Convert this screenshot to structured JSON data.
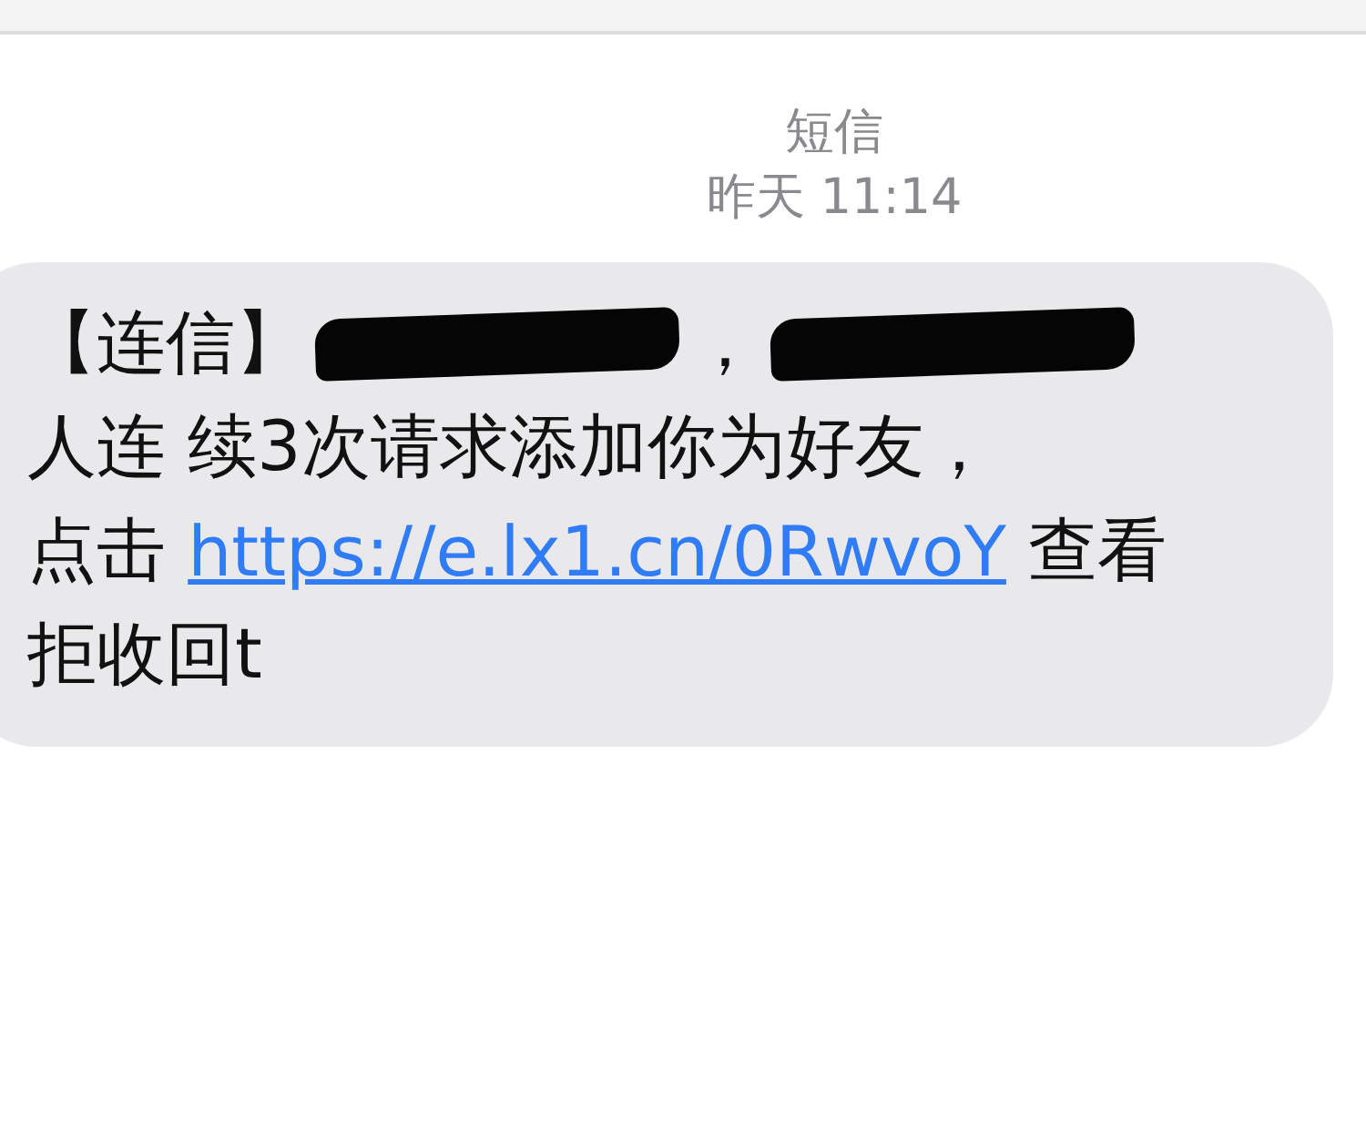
{
  "header": {
    "sender": "短信",
    "timestamp": "昨天 11:14"
  },
  "message": {
    "lines": [
      [
        {
          "kind": "text",
          "text": "【连信】"
        },
        {
          "kind": "redacted"
        },
        {
          "kind": "text",
          "text": "，"
        },
        {
          "kind": "redacted"
        }
      ],
      [
        {
          "kind": "text",
          "text": "人连 续3次请求添加你为好友，"
        }
      ],
      [
        {
          "kind": "text",
          "text": "点击 "
        },
        {
          "kind": "link",
          "text": "https://e.lx1.cn/0RwvoY"
        },
        {
          "kind": "text",
          "text": " 查看"
        }
      ],
      [
        {
          "kind": "text",
          "text": "拒收回t"
        }
      ]
    ]
  }
}
